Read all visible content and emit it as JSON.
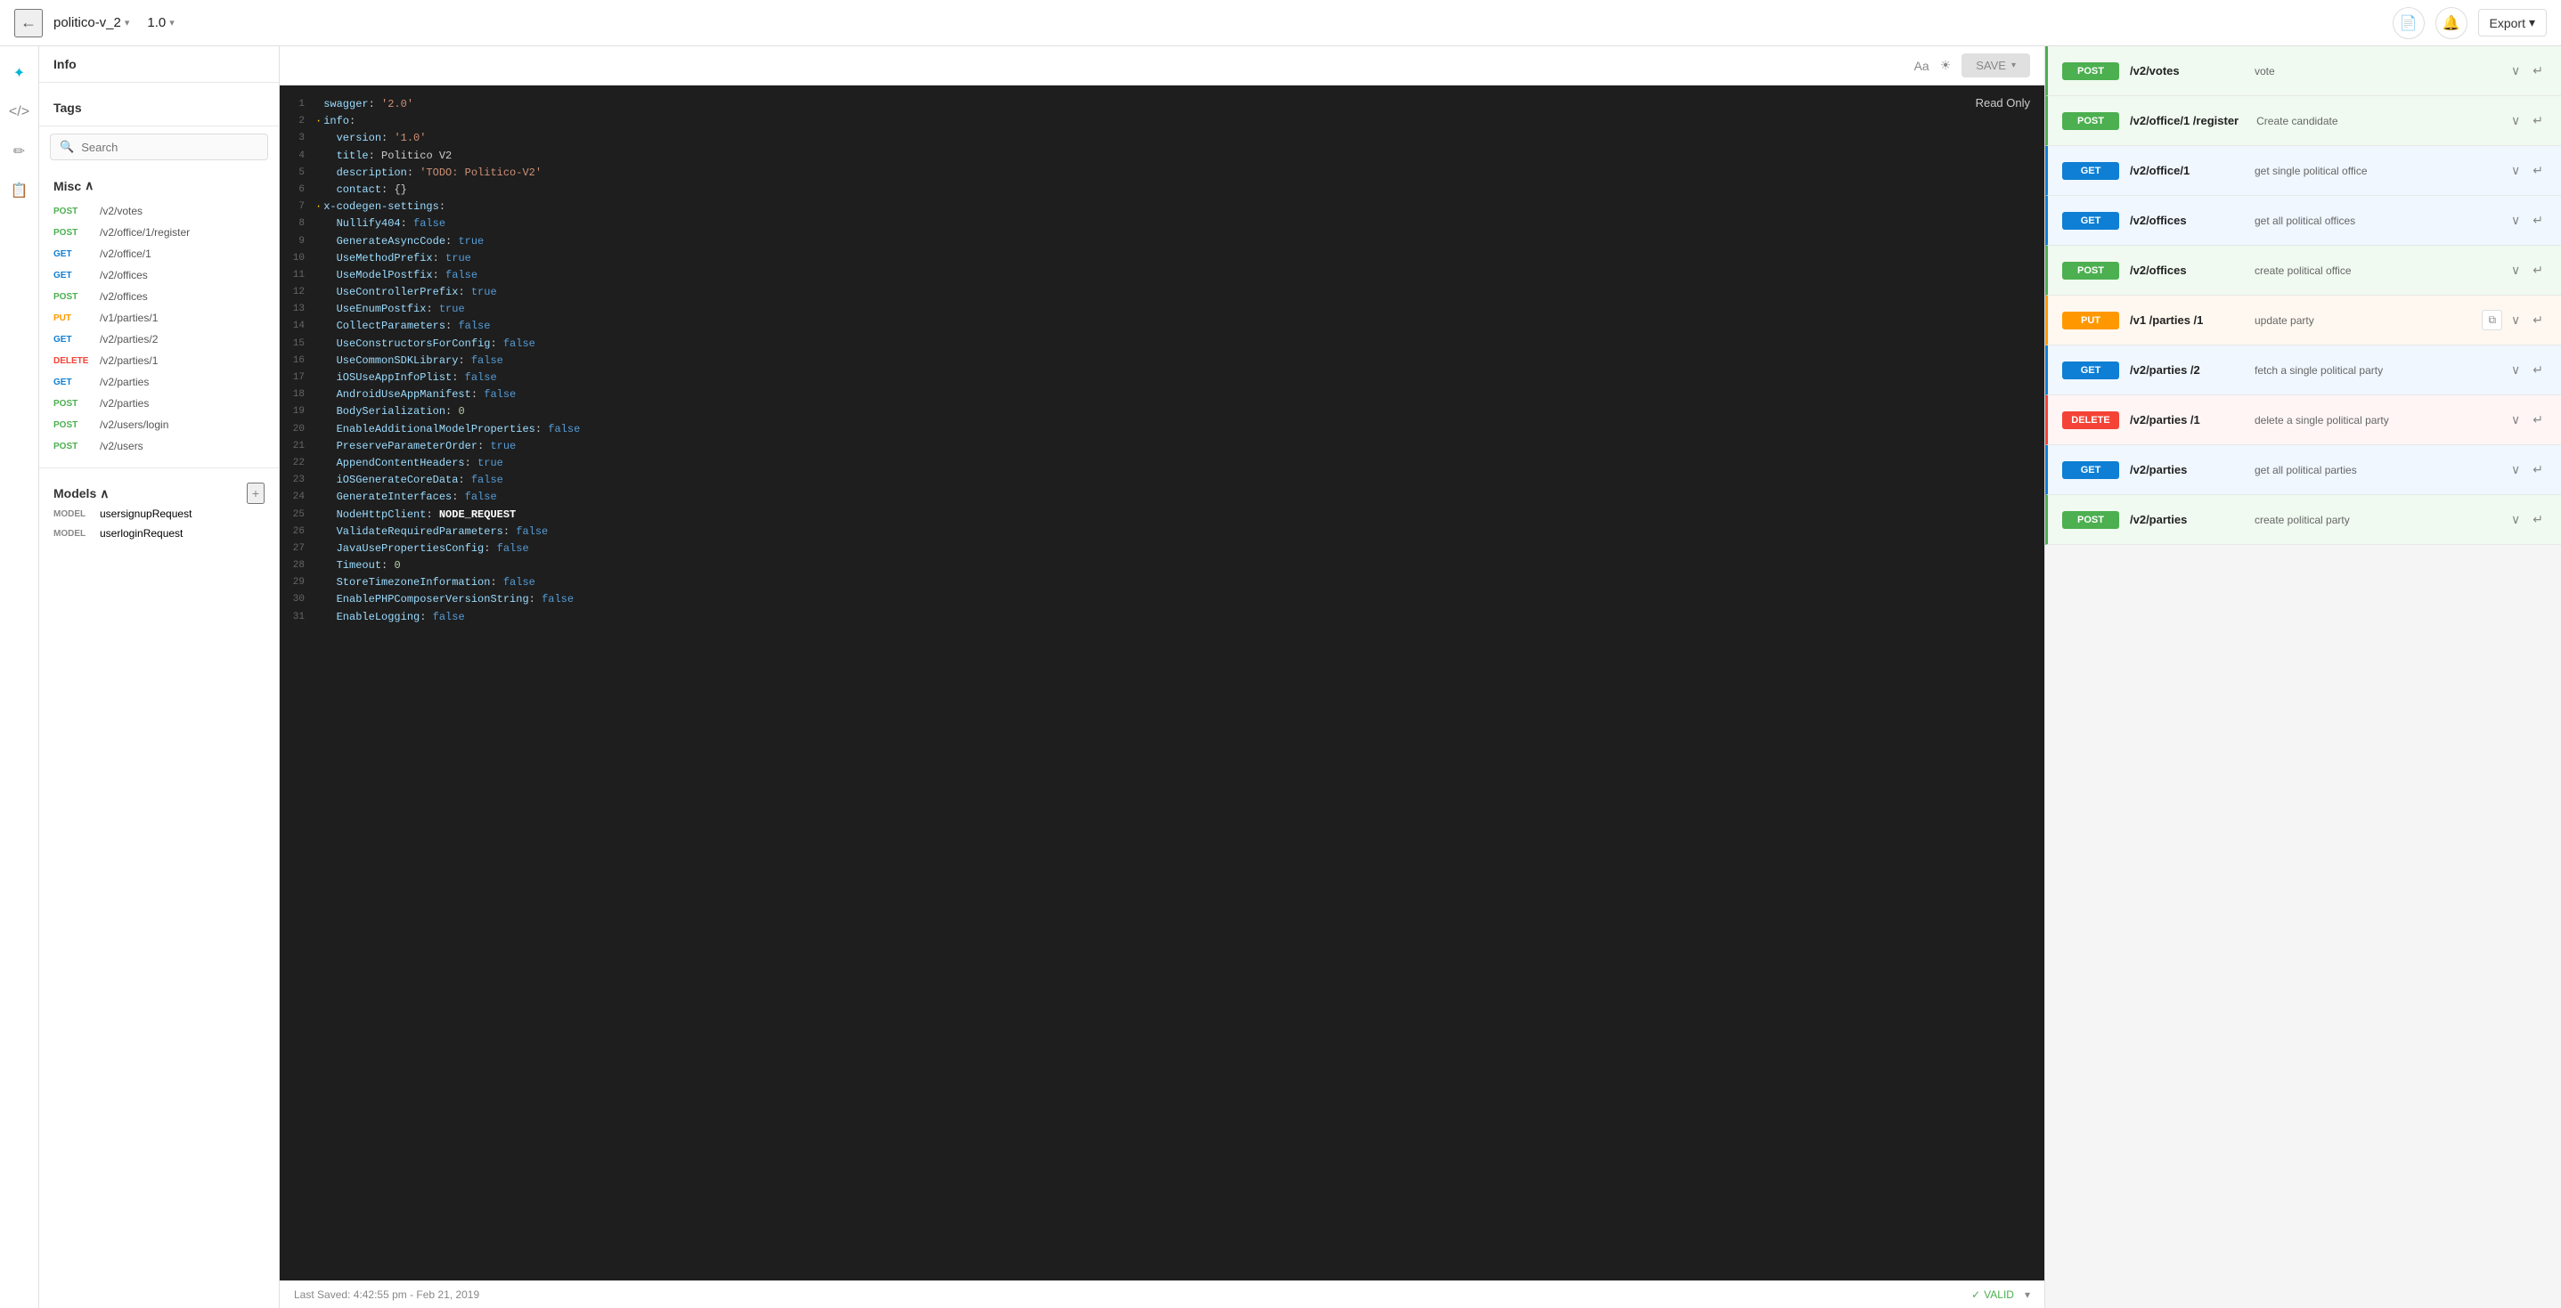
{
  "app": {
    "title": "politico-v_2",
    "version": "1.0",
    "back_label": "←",
    "export_label": "Export"
  },
  "toolbar": {
    "font_label": "Aa",
    "theme_label": "☀",
    "save_label": "SAVE"
  },
  "left_panel": {
    "info_label": "Info",
    "tags_label": "Tags",
    "search_placeholder": "Search",
    "misc_label": "Misc",
    "models_label": "Models",
    "add_icon": "+"
  },
  "endpoints": [
    {
      "method": "POST",
      "path": "/v2/votes"
    },
    {
      "method": "POST",
      "path": "/v2/office/1/register"
    },
    {
      "method": "GET",
      "path": "/v2/office/1"
    },
    {
      "method": "GET",
      "path": "/v2/offices"
    },
    {
      "method": "POST",
      "path": "/v2/offices"
    },
    {
      "method": "PUT",
      "path": "/v1/parties/1"
    },
    {
      "method": "GET",
      "path": "/v2/parties/2"
    },
    {
      "method": "DELETE",
      "path": "/v2/parties/1"
    },
    {
      "method": "GET",
      "path": "/v2/parties"
    },
    {
      "method": "POST",
      "path": "/v2/parties"
    },
    {
      "method": "POST",
      "path": "/v2/users/login"
    },
    {
      "method": "POST",
      "path": "/v2/users"
    }
  ],
  "models": [
    {
      "name": "usersignupRequest"
    },
    {
      "name": "userloginRequest"
    }
  ],
  "code_lines": [
    {
      "num": 1,
      "content": "swagger: '2.0'"
    },
    {
      "num": 2,
      "content": "info:",
      "dot": true
    },
    {
      "num": 3,
      "content": "  version: '1.0'"
    },
    {
      "num": 4,
      "content": "  title: Politico V2"
    },
    {
      "num": 5,
      "content": "  description: 'TODO: Politico-V2'"
    },
    {
      "num": 6,
      "content": "  contact: {}"
    },
    {
      "num": 7,
      "content": "x-codegen-settings:",
      "dot": true
    },
    {
      "num": 8,
      "content": "  Nullify404: false"
    },
    {
      "num": 9,
      "content": "  GenerateAsyncCode: true"
    },
    {
      "num": 10,
      "content": "  UseMethodPrefix: true"
    },
    {
      "num": 11,
      "content": "  UseModelPostfix: false"
    },
    {
      "num": 12,
      "content": "  UseControllerPrefix: true"
    },
    {
      "num": 13,
      "content": "  UseEnumPostfix: true"
    },
    {
      "num": 14,
      "content": "  CollectParameters: false"
    },
    {
      "num": 15,
      "content": "  UseConstructorsForConfig: false"
    },
    {
      "num": 16,
      "content": "  UseCommonSDKLibrary: false"
    },
    {
      "num": 17,
      "content": "  iOSUseAppInfoPlist: false"
    },
    {
      "num": 18,
      "content": "  AndroidUseAppManifest: false"
    },
    {
      "num": 19,
      "content": "  BodySerialization: 0"
    },
    {
      "num": 20,
      "content": "  EnableAdditionalModelProperties: false"
    },
    {
      "num": 21,
      "content": "  PreserveParameterOrder: true"
    },
    {
      "num": 22,
      "content": "  AppendContentHeaders: true"
    },
    {
      "num": 23,
      "content": "  iOSGenerateCoreData: false"
    },
    {
      "num": 24,
      "content": "  GenerateInterfaces: false"
    },
    {
      "num": 25,
      "content": "  NodeHttpClient: NODE_REQUEST"
    },
    {
      "num": 26,
      "content": "  ValidateRequiredParameters: false"
    },
    {
      "num": 27,
      "content": "  JavaUsePropertiesConfig: false"
    },
    {
      "num": 28,
      "content": "  Timeout: 0"
    },
    {
      "num": 29,
      "content": "  StoreTimezoneInformation: false"
    },
    {
      "num": 30,
      "content": "  EnablePHPComposerVersionString: false"
    },
    {
      "num": 31,
      "content": "  EnableLogging: false"
    }
  ],
  "editor_footer": {
    "saved_label": "Last Saved: 4:42:55 pm  -  Feb 21, 2019",
    "valid_label": "VALID"
  },
  "read_only_label": "Read Only",
  "api_list": [
    {
      "method": "POST",
      "path": "/v2/votes",
      "desc": "vote",
      "color": "green"
    },
    {
      "method": "POST",
      "path": "/v2/office/1 /register",
      "desc": "Create candidate",
      "color": "green"
    },
    {
      "method": "GET",
      "path": "/v2/office/1",
      "desc": "get single political office",
      "color": "blue"
    },
    {
      "method": "GET",
      "path": "/v2/offices",
      "desc": "get all political offices",
      "color": "blue"
    },
    {
      "method": "POST",
      "path": "/v2/offices",
      "desc": "create political office",
      "color": "green"
    },
    {
      "method": "PUT",
      "path": "/v1 /parties /1",
      "desc": "update party",
      "color": "orange",
      "has_copy": true
    },
    {
      "method": "GET",
      "path": "/v2/parties /2",
      "desc": "fetch a single political party",
      "color": "blue"
    },
    {
      "method": "DELETE",
      "path": "/v2/parties /1",
      "desc": "delete a single political party",
      "color": "red"
    },
    {
      "method": "GET",
      "path": "/v2/parties",
      "desc": "get all political parties",
      "color": "blue"
    },
    {
      "method": "POST",
      "path": "/v2/parties",
      "desc": "create political party",
      "color": "green"
    }
  ],
  "icons": {
    "back": "←",
    "chevron_down": "▾",
    "search": "🔍",
    "bell": "🔔",
    "doc": "📄",
    "gear": "⚙",
    "pen": "✏",
    "file": "📋",
    "chevron_right": "›",
    "expand": "∨",
    "enter": "↵",
    "copy": "⧉",
    "plus": "+"
  }
}
